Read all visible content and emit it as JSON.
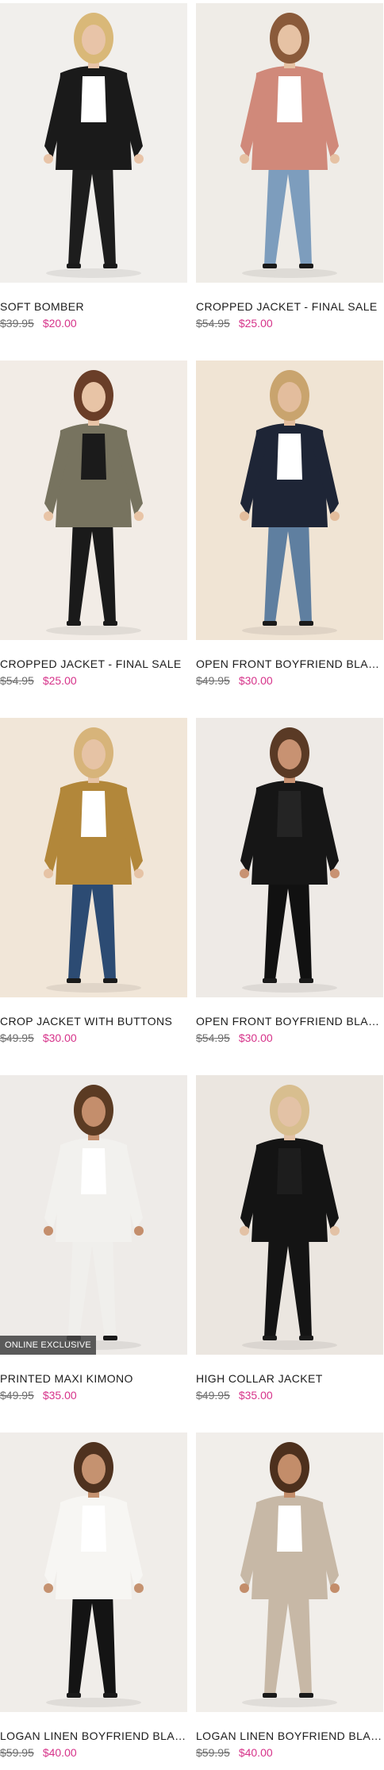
{
  "colors": {
    "sale_price": "#d6338a",
    "regular_price": "#6e6e6e",
    "badge_bg": "#464646"
  },
  "products": [
    {
      "name": "SOFT BOMBER",
      "original_price": "$39.95",
      "sale_price": "$20.00",
      "badge": "",
      "image": {
        "bg": "#f1efec",
        "top": "#1a1a1a",
        "inner": "#ffffff",
        "bottom": "#1d1d1d",
        "skin": "#e8c4a8",
        "hair": "#d9b878"
      }
    },
    {
      "name": "CROPPED JACKET - FINAL SALE",
      "original_price": "$54.95",
      "sale_price": "$25.00",
      "badge": "",
      "image": {
        "bg": "#efece7",
        "top": "#d0897a",
        "inner": "#ffffff",
        "bottom": "#7d9dbd",
        "skin": "#e6c2a4",
        "hair": "#8a5a3a"
      }
    },
    {
      "name": "CROPPED JACKET - FINAL SALE",
      "original_price": "$54.95",
      "sale_price": "$25.00",
      "badge": "",
      "image": {
        "bg": "#f2ece6",
        "top": "#77735f",
        "inner": "#1b1b1b",
        "bottom": "#1a1a1a",
        "skin": "#e8c4a6",
        "hair": "#6a3e28"
      }
    },
    {
      "name": "OPEN FRONT BOYFRIEND BLAZER",
      "original_price": "$49.95",
      "sale_price": "$30.00",
      "badge": "",
      "image": {
        "bg": "#f0e4d4",
        "top": "#1e2536",
        "inner": "#ffffff",
        "bottom": "#5f7fa0",
        "skin": "#e3bd9d",
        "hair": "#c9a46e"
      }
    },
    {
      "name": "CROP JACKET WITH BUTTONS",
      "original_price": "$49.95",
      "sale_price": "$30.00",
      "badge": "",
      "image": {
        "bg": "#f1e6d8",
        "top": "#b2873a",
        "inner": "#ffffff",
        "bottom": "#2c4b73",
        "skin": "#e6c3a5",
        "hair": "#d7b47a"
      }
    },
    {
      "name": "OPEN FRONT BOYFRIEND BLAZER",
      "original_price": "$54.95",
      "sale_price": "$30.00",
      "badge": "",
      "image": {
        "bg": "#eeeae6",
        "top": "#161616",
        "inner": "#242424",
        "bottom": "#111111",
        "skin": "#c89272",
        "hair": "#5a3a25"
      }
    },
    {
      "name": "PRINTED MAXI KIMONO",
      "original_price": "$49.95",
      "sale_price": "$35.00",
      "badge": "ONLINE EXCLUSIVE",
      "image": {
        "bg": "#eeebe8",
        "top": "#f2f1ee",
        "inner": "#ffffff",
        "bottom": "#f0efec",
        "skin": "#c48e6c",
        "hair": "#5b3b23"
      }
    },
    {
      "name": "HIGH COLLAR JACKET",
      "original_price": "$49.95",
      "sale_price": "$35.00",
      "badge": "",
      "image": {
        "bg": "#ebe6e0",
        "top": "#141414",
        "inner": "#1d1d1d",
        "bottom": "#141414",
        "skin": "#e3c2a6",
        "hair": "#d8be8f"
      }
    },
    {
      "name": "LOGAN LINEN BOYFRIEND BLAZER",
      "original_price": "$59.95",
      "sale_price": "$40.00",
      "badge": "",
      "image": {
        "bg": "#f0ede9",
        "top": "#f7f6f3",
        "inner": "#ffffff",
        "bottom": "#141414",
        "skin": "#c59270",
        "hair": "#4f321f"
      }
    },
    {
      "name": "LOGAN LINEN BOYFRIEND BLAZER",
      "original_price": "$59.95",
      "sale_price": "$40.00",
      "badge": "",
      "image": {
        "bg": "#f1eeea",
        "top": "#c7b8a6",
        "inner": "#ffffff",
        "bottom": "#c7b8a6",
        "skin": "#c38d6a",
        "hair": "#4d301d"
      }
    }
  ]
}
